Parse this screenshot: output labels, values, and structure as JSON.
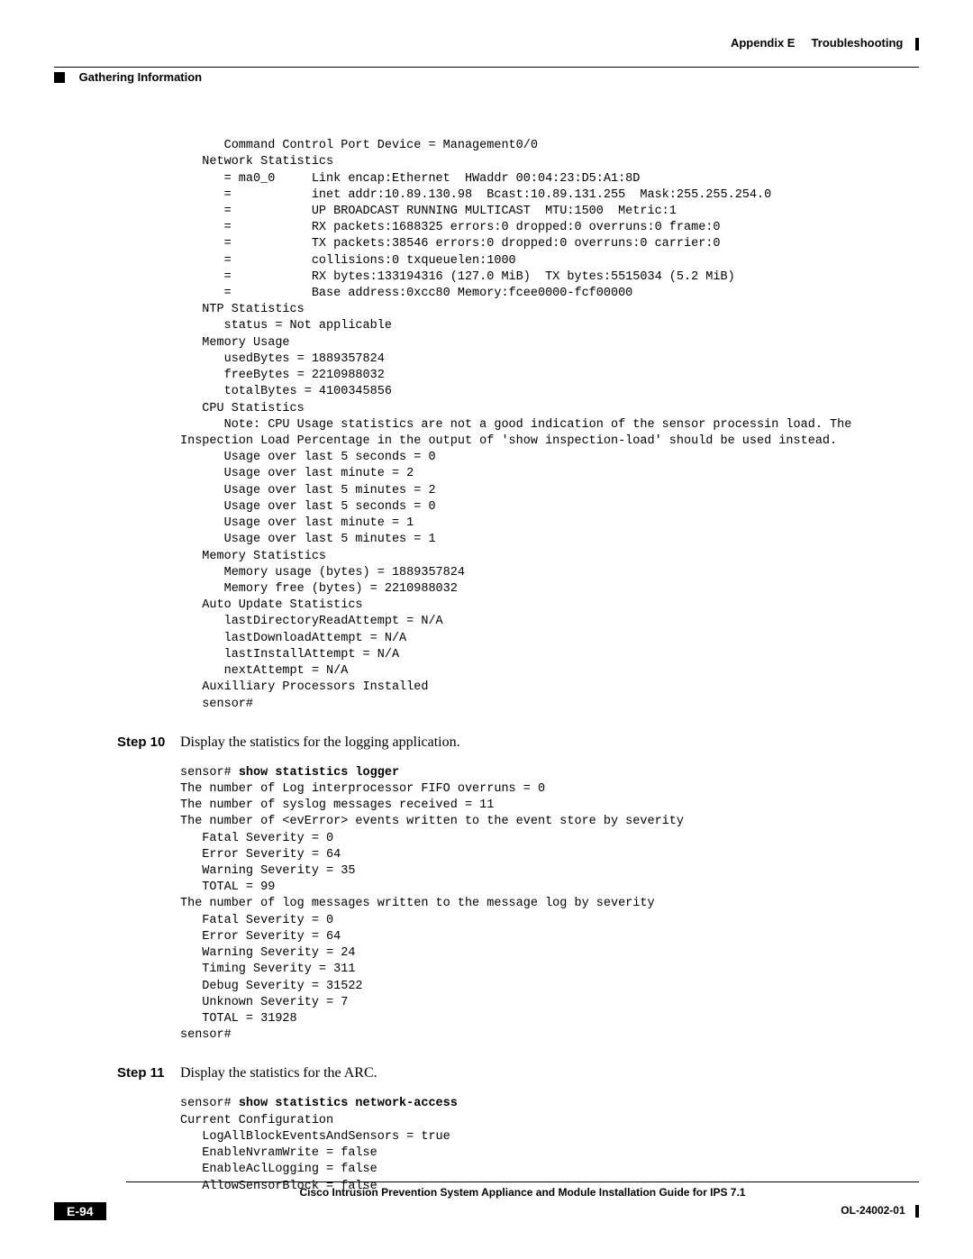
{
  "header": {
    "appendix": "Appendix E",
    "chapter": "Troubleshooting",
    "section": "Gathering Information"
  },
  "code1": "      Command Control Port Device = Management0/0\n   Network Statistics\n      = ma0_0     Link encap:Ethernet  HWaddr 00:04:23:D5:A1:8D\n      =           inet addr:10.89.130.98  Bcast:10.89.131.255  Mask:255.255.254.0\n      =           UP BROADCAST RUNNING MULTICAST  MTU:1500  Metric:1\n      =           RX packets:1688325 errors:0 dropped:0 overruns:0 frame:0\n      =           TX packets:38546 errors:0 dropped:0 overruns:0 carrier:0\n      =           collisions:0 txqueuelen:1000\n      =           RX bytes:133194316 (127.0 MiB)  TX bytes:5515034 (5.2 MiB)\n      =           Base address:0xcc80 Memory:fcee0000-fcf00000\n   NTP Statistics\n      status = Not applicable\n   Memory Usage\n      usedBytes = 1889357824\n      freeBytes = 2210988032\n      totalBytes = 4100345856\n   CPU Statistics\n      Note: CPU Usage statistics are not a good indication of the sensor processin load. The \nInspection Load Percentage in the output of 'show inspection-load' should be used instead.\n      Usage over last 5 seconds = 0\n      Usage over last minute = 2\n      Usage over last 5 minutes = 2\n      Usage over last 5 seconds = 0\n      Usage over last minute = 1\n      Usage over last 5 minutes = 1\n   Memory Statistics\n      Memory usage (bytes) = 1889357824\n      Memory free (bytes) = 2210988032\n   Auto Update Statistics\n      lastDirectoryReadAttempt = N/A\n      lastDownloadAttempt = N/A\n      lastInstallAttempt = N/A\n      nextAttempt = N/A\n   Auxilliary Processors Installed\n   sensor#",
  "steps": [
    {
      "label": "Step 10",
      "text": "Display the statistics for the logging application.",
      "prompt": "sensor# ",
      "command": "show statistics logger",
      "output": "The number of Log interprocessor FIFO overruns = 0\nThe number of syslog messages received = 11\nThe number of <evError> events written to the event store by severity\n   Fatal Severity = 0\n   Error Severity = 64\n   Warning Severity = 35\n   TOTAL = 99\nThe number of log messages written to the message log by severity\n   Fatal Severity = 0\n   Error Severity = 64\n   Warning Severity = 24\n   Timing Severity = 311\n   Debug Severity = 31522\n   Unknown Severity = 7\n   TOTAL = 31928\nsensor#"
    },
    {
      "label": "Step 11",
      "text": "Display the statistics for the ARC.",
      "prompt": "sensor# ",
      "command": "show statistics network-access",
      "output": "Current Configuration\n   LogAllBlockEventsAndSensors = true\n   EnableNvramWrite = false\n   EnableAclLogging = false\n   AllowSensorBlock = false"
    }
  ],
  "footer": {
    "title": "Cisco Intrusion Prevention System Appliance and Module Installation Guide for IPS 7.1",
    "page": "E-94",
    "docnum": "OL-24002-01"
  }
}
